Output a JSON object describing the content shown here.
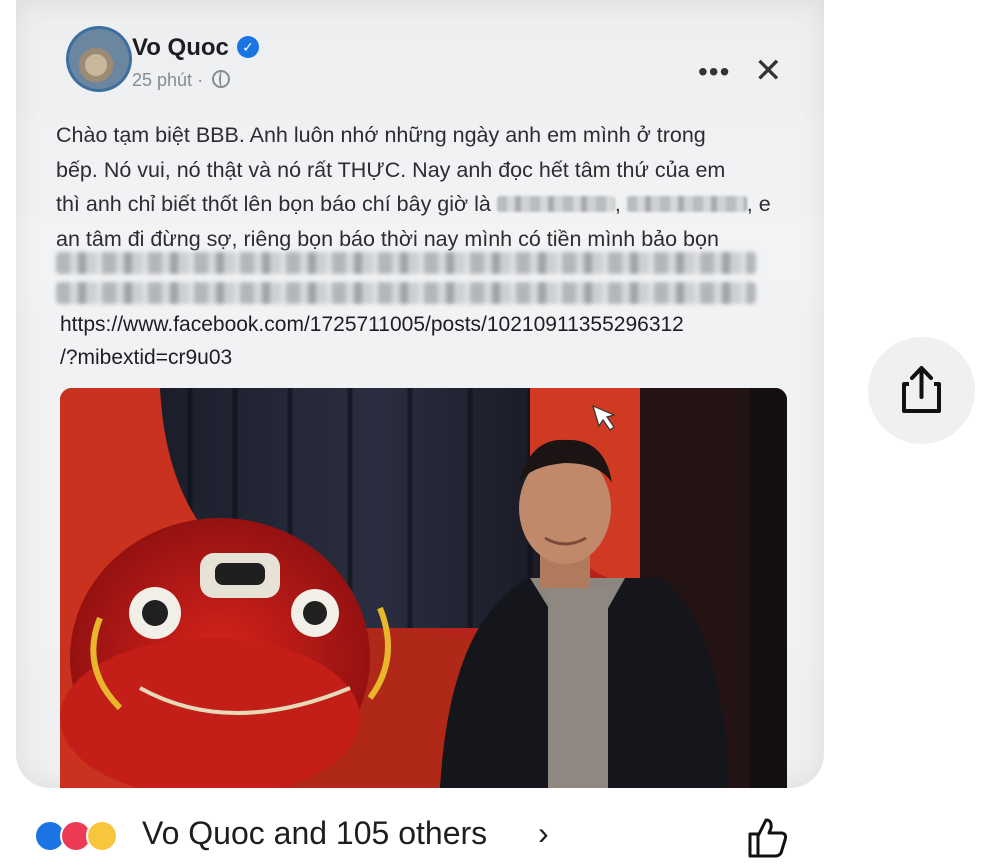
{
  "post": {
    "author": "Vo Quoc",
    "time": "25 phút",
    "separator": "·",
    "text_line1": "Chào tạm biệt BBB. Anh luôn nhớ những ngày anh em mình ở trong",
    "text_line2": "bếp. Nó vui, nó thật và nó rất THỰC. Nay anh đọc hết tâm thứ của em",
    "text_line3_a": "thì anh chỉ biết thốt lên bọn báo chí bây giờ là",
    "text_line3_b": ",",
    "text_line3_c": ", e",
    "text_line4": "an tâm đi đừng sợ, riêng bọn báo thời nay mình có tiền mình bảo bọn",
    "link_line1": "https://www.facebook.com/1725711005/posts/10210911355296312",
    "link_line2": "/?mibextid=cr9u03"
  },
  "icons": {
    "verified": "verified-badge-icon",
    "globe": "globe-icon",
    "more": "more-options-icon",
    "close": "close-icon",
    "share": "share-icon",
    "like": "thumbs-up-icon",
    "chevron": "chevron-right-icon"
  },
  "glyphs": {
    "more": "•••",
    "close": "✕",
    "verified": "✓",
    "chevron": "›"
  },
  "footer": {
    "reactions_text": "Vo Quoc and 105 others"
  },
  "colors": {
    "accent": "#1b74e4",
    "love": "#ee3b55",
    "care": "#f7c63d"
  }
}
